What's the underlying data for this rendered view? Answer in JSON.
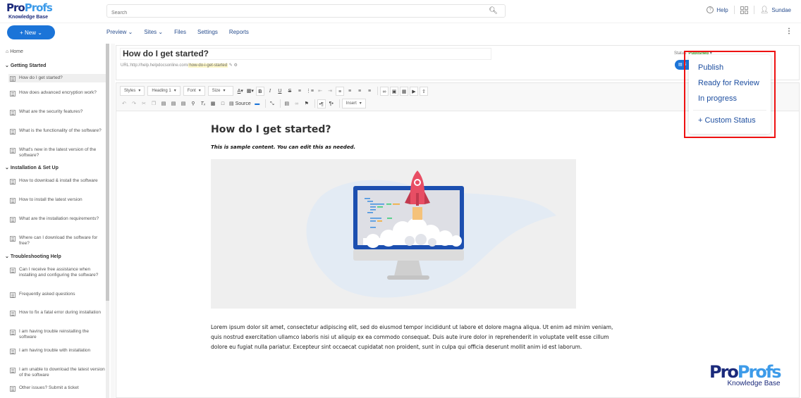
{
  "brand": {
    "name_part1": "Pro",
    "name_part2": "Profs",
    "product": "Knowledge Base",
    "primary_color": "#1b74d8",
    "dark_color": "#1b2a7b",
    "light_color": "#3d9be9"
  },
  "search": {
    "placeholder": "Search"
  },
  "top_right": {
    "help": "Help",
    "user": "Sundae"
  },
  "navbar": {
    "new_label": "+ New ⌄",
    "links": [
      "Preview ⌄",
      "Sites ⌄",
      "Files",
      "Settings",
      "Reports"
    ]
  },
  "sidebar": {
    "home": "Home",
    "sections": [
      {
        "title": "Getting Started",
        "items": [
          "How do I get started?",
          "How does advanced encryption work?",
          "What are the security features?",
          "What is the functionality of the software?",
          "What's new in the latest version of the software?"
        ]
      },
      {
        "title": "Installation & Set Up",
        "items": [
          "How to download & install the software",
          "How to install the latest version",
          "What are the installation requirements?",
          "Where can I download the software for free?"
        ]
      },
      {
        "title": "Troubleshooting Help",
        "items": [
          "Can I receive free assistance when installing and configuring the software?",
          "Frequently asked questions",
          "How to fix a fatal error during installation",
          "I am having trouble reinstalling the software",
          "I am having trouble with installation",
          "I am unable to download the latest version of the software",
          "Other issues? Submit a ticket"
        ]
      }
    ],
    "active_item": "How do I get started?"
  },
  "article": {
    "title": "How do I get started?",
    "url_prefix": "URL:http://help.helpdocsonline.com/",
    "url_slug": "how-do-i-get-started",
    "status_label": "Status:",
    "status_value": "Published",
    "save_label": "S"
  },
  "toolbar": {
    "combos": [
      "Styles",
      "Heading 1",
      "Font",
      "Size"
    ],
    "source_label": "Source",
    "insert_label": "Insert"
  },
  "content": {
    "heading": "How do I get started?",
    "note": "This is sample content. You can edit this as needed.",
    "body": "Lorem ipsum dolor sit amet, consectetur adipiscing elit, sed do eiusmod tempor incididunt ut labore et dolore magna aliqua. Ut enim ad minim veniam, quis nostrud exercitation ullamco laboris nisi ut aliquip ex ea commodo consequat. Duis aute irure dolor in reprehenderit in voluptate velit esse cillum dolore eu fugiat nulla pariatur. Excepteur sint occaecat cupidatat non proident, sunt in culpa qui officia deserunt mollit anim id est laborum."
  },
  "status_dropdown": {
    "options": [
      "Publish",
      "Ready for Review",
      "In progress"
    ],
    "custom": "+ Custom Status",
    "highlight_color": "#e11111"
  }
}
